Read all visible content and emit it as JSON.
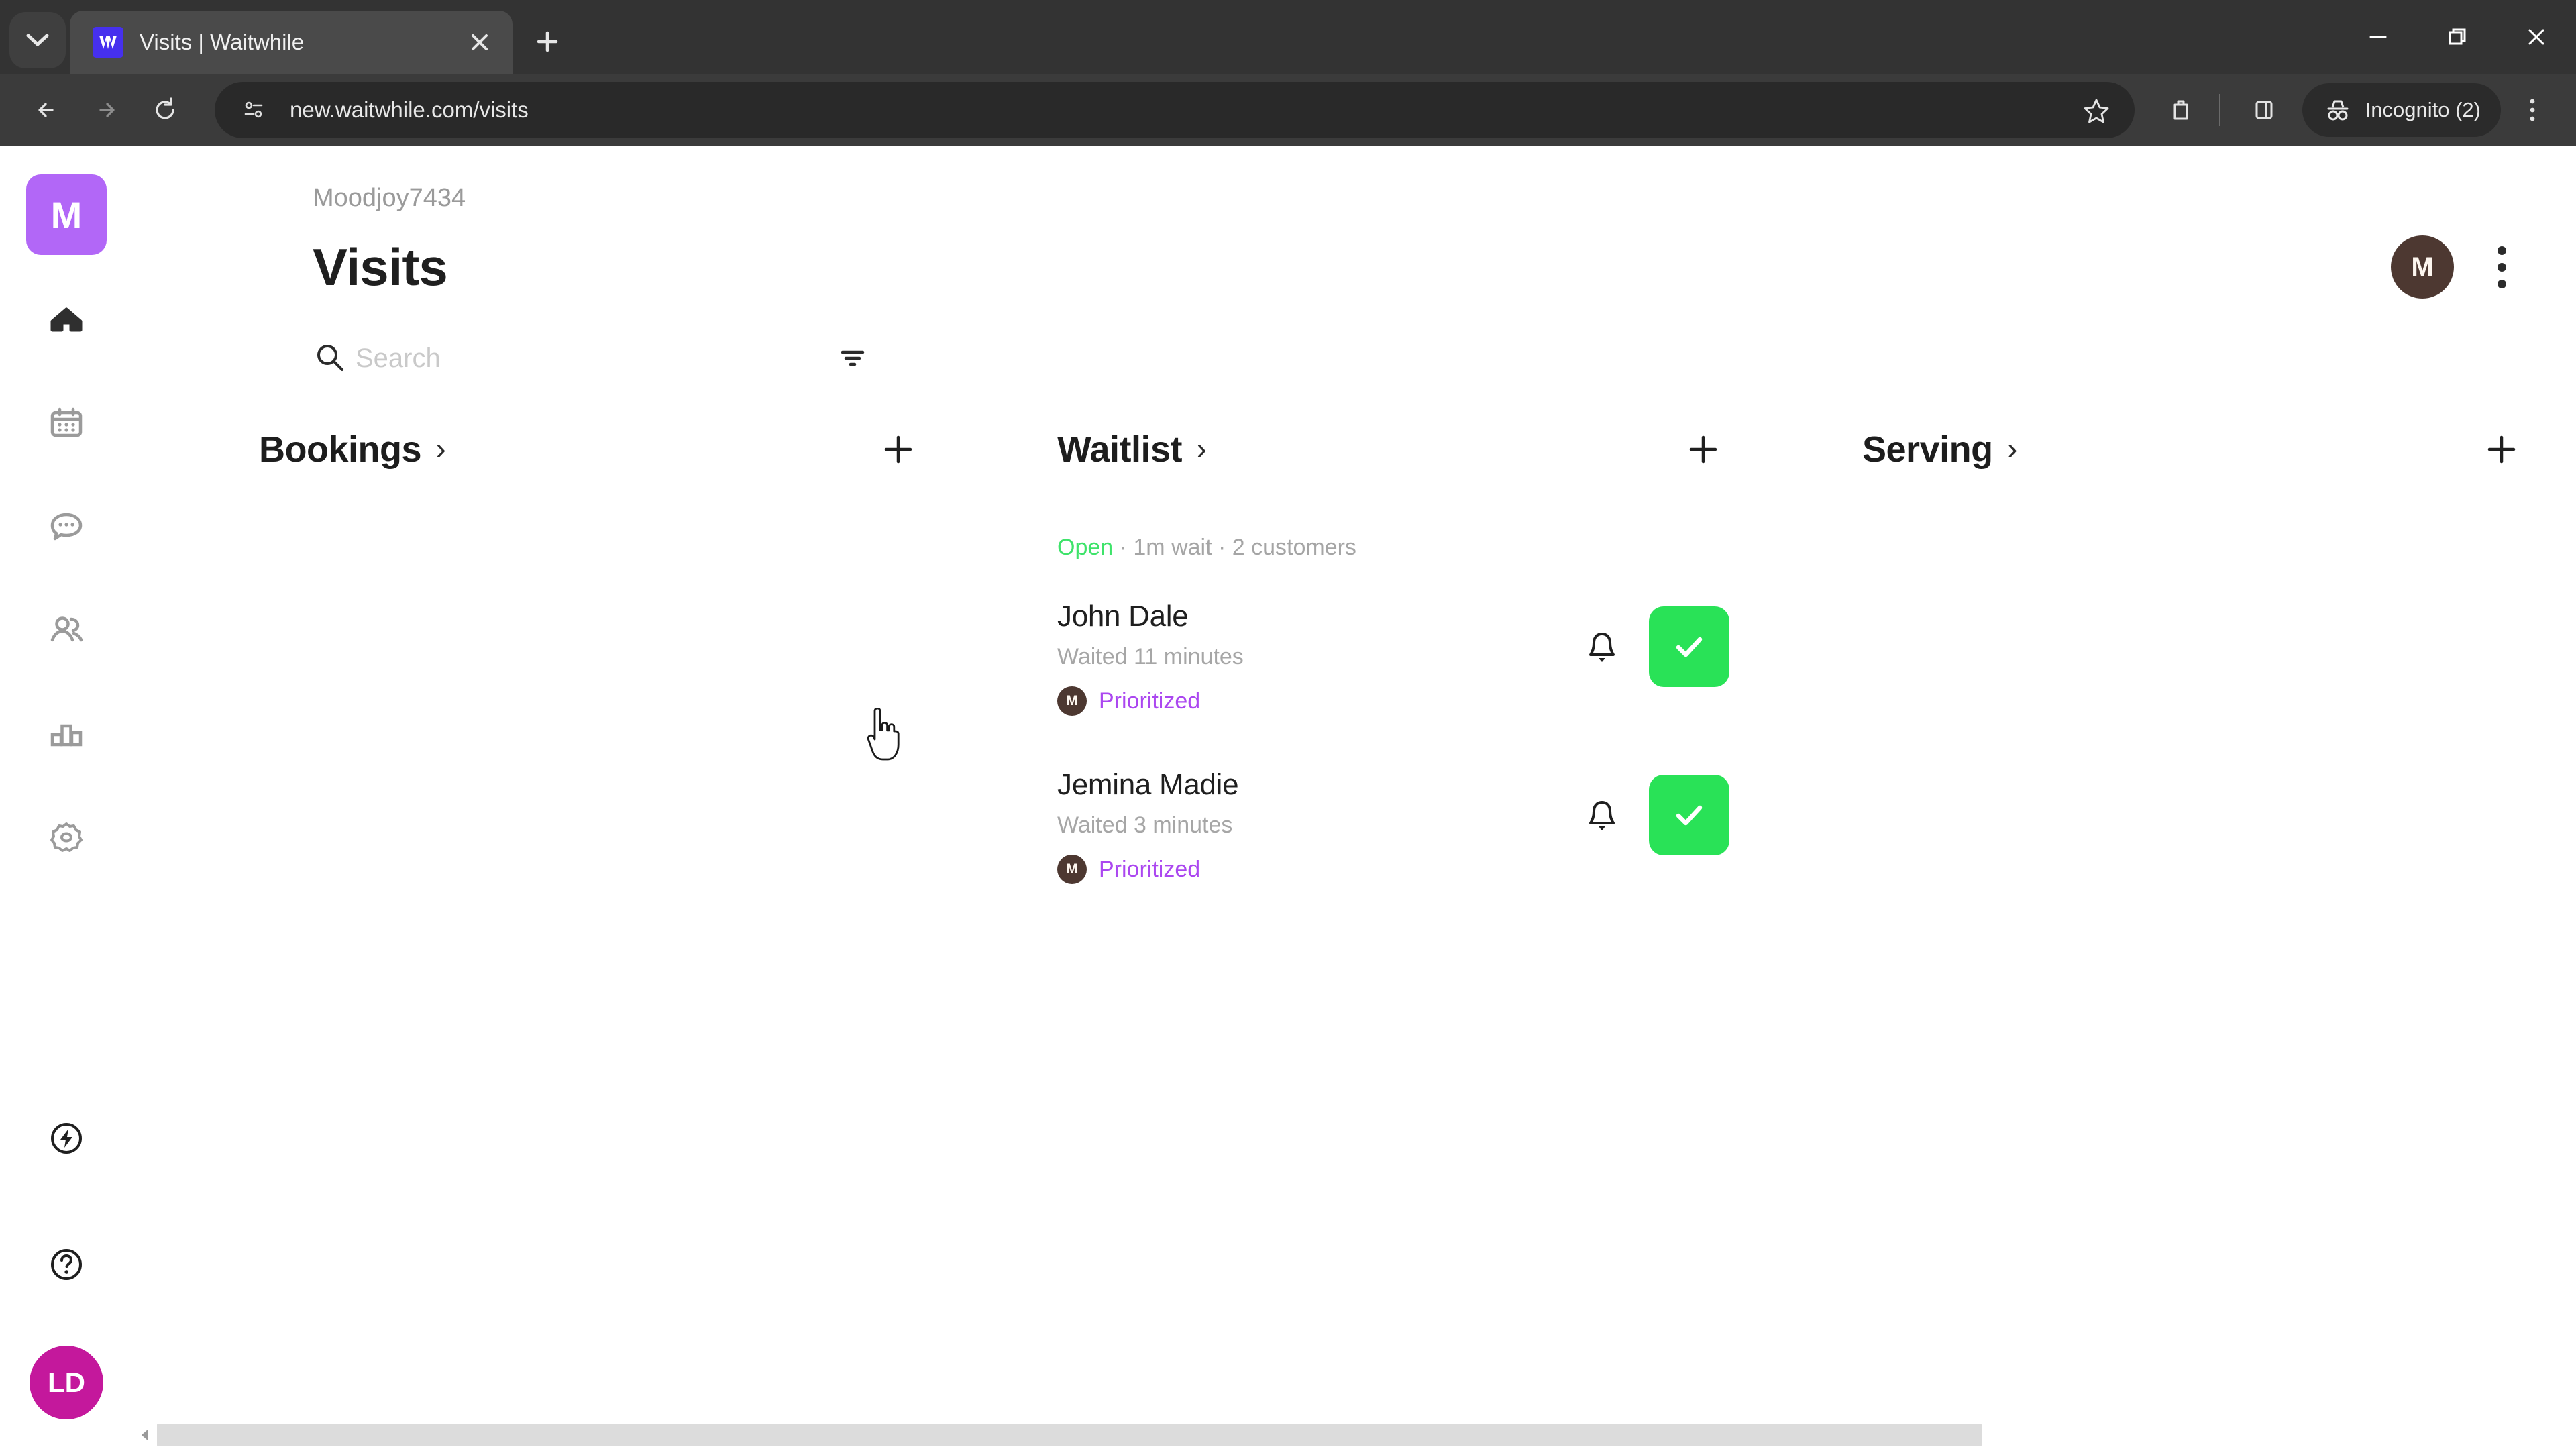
{
  "browser": {
    "tab": {
      "title": "Visits | Waitwhile",
      "favicon_name": "waitwhile-favicon",
      "favicon_color": "#4630ee"
    },
    "tab_list_icon": "chevron-down-icon",
    "new_tab_label": "+",
    "close_tab_label": "×",
    "nav": {
      "back": "←",
      "forward": "→",
      "reload": "↻"
    },
    "omnibox": {
      "url": "new.waitwhile.com/visits",
      "site_info_icon": "site-settings-icon",
      "bookmark_icon": "star-icon"
    },
    "toolbar": {
      "extensions_icon": "extensions-icon",
      "side_panel_icon": "side-panel-icon",
      "menu_icon": "three-dot-menu-icon",
      "incognito_label": "Incognito (2)",
      "incognito_icon": "incognito-icon"
    },
    "window": {
      "minimize": "minimize-icon",
      "restore": "restore-icon",
      "close": "close-icon"
    }
  },
  "sidebar": {
    "brand": {
      "initial": "M",
      "color": "#b267f7"
    },
    "items": [
      {
        "name": "home",
        "icon": "home-icon",
        "active": true
      },
      {
        "name": "calendar",
        "icon": "calendar-icon",
        "active": false
      },
      {
        "name": "messages",
        "icon": "chat-bubble-icon",
        "active": false
      },
      {
        "name": "customers",
        "icon": "people-icon",
        "active": false
      },
      {
        "name": "analytics",
        "icon": "bar-chart-icon",
        "active": false
      },
      {
        "name": "settings",
        "icon": "gear-icon",
        "active": false
      }
    ],
    "bottom_items": [
      {
        "name": "integrations",
        "icon": "lightning-bolt-icon"
      },
      {
        "name": "help",
        "icon": "question-mark-icon"
      }
    ],
    "user_avatar": {
      "initials": "LD",
      "color": "#c4189c"
    }
  },
  "header": {
    "breadcrumb": "Moodjoy7434",
    "title": "Visits",
    "avatar_initial": "M",
    "avatar_color": "#4d3831",
    "menu_icon": "kebab-menu-icon"
  },
  "search": {
    "placeholder": "Search",
    "value": "",
    "search_icon": "search-icon",
    "filter_icon": "filter-icon"
  },
  "columns": [
    {
      "id": "bookings",
      "title": "Bookings",
      "chevron": "›",
      "add_label": "+",
      "status": null,
      "cards": []
    },
    {
      "id": "waitlist",
      "title": "Waitlist",
      "chevron": "›",
      "add_label": "+",
      "status": {
        "state": "Open",
        "state_color": "#3ee36a",
        "detail": " · 1m wait · 2 customers"
      },
      "cards": [
        {
          "name": "John Dale",
          "waited": "Waited 11 minutes",
          "tag_avatar": "M",
          "tag_label": "Prioritized",
          "tag_color": "#ab47f0",
          "bell_icon": "bell-icon",
          "serve_icon": "check-icon",
          "serve_color": "#29e257"
        },
        {
          "name": "Jemina Madie",
          "waited": "Waited 3 minutes",
          "tag_avatar": "M",
          "tag_label": "Prioritized",
          "tag_color": "#ab47f0",
          "bell_icon": "bell-icon",
          "serve_icon": "check-icon",
          "serve_color": "#29e257"
        }
      ]
    },
    {
      "id": "serving",
      "title": "Serving",
      "chevron": "›",
      "add_label": "+",
      "status": null,
      "cards": []
    }
  ],
  "scrollbar": {
    "left_arrow": "scroll-left-arrow",
    "orientation": "horizontal"
  }
}
